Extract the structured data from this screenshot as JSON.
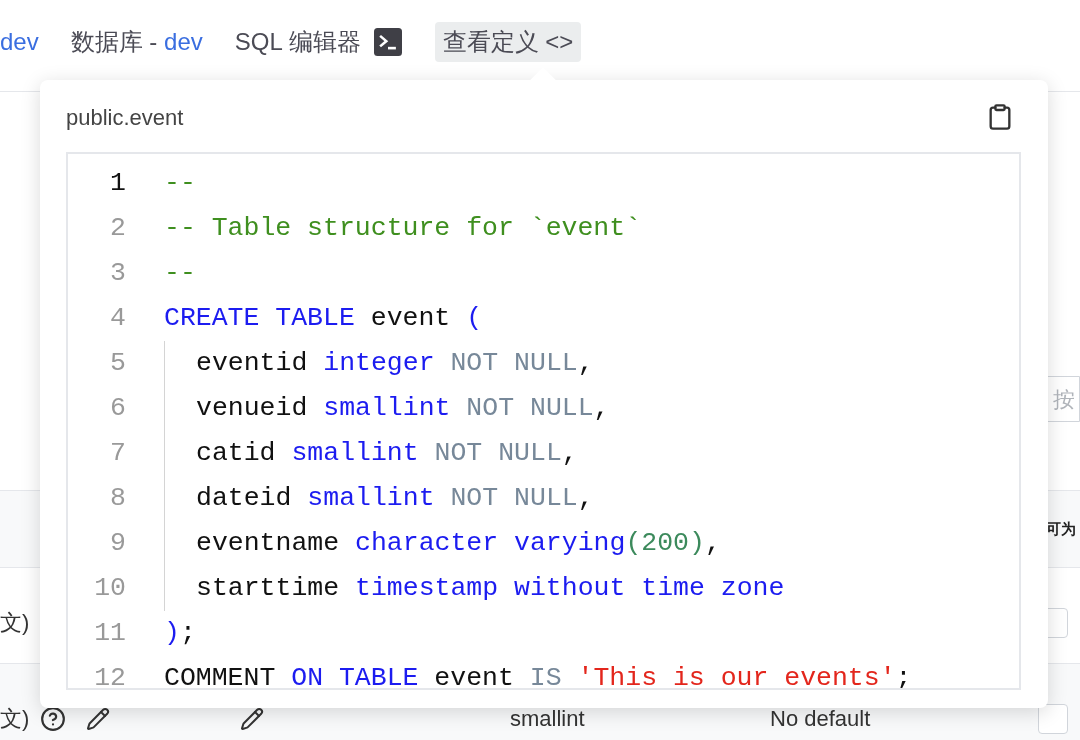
{
  "breadcrumb": [
    {
      "link": "dev"
    },
    {
      "label": "数据库 - ",
      "link": "dev"
    }
  ],
  "editor_link": {
    "label": "SQL 编辑器"
  },
  "view_definition_button": {
    "label": "查看定义",
    "symbol": "<>",
    "selected": true
  },
  "background": {
    "search_placeholder": "按",
    "header_cell": "可为",
    "rows": [
      {
        "column_1": "文)",
        "checked": false
      },
      {
        "column_1": "文)",
        "type": "smallint",
        "default": "No default",
        "checked": false
      }
    ]
  },
  "popover": {
    "title": "public.event",
    "lines": [
      {
        "number": "1",
        "indented": false,
        "tokens": [
          {
            "kind": "comment",
            "text": "--"
          }
        ]
      },
      {
        "number": "2",
        "indented": false,
        "tokens": [
          {
            "kind": "comment",
            "text": "-- Table structure for `event`"
          }
        ]
      },
      {
        "number": "3",
        "indented": false,
        "tokens": [
          {
            "kind": "comment",
            "text": "--"
          }
        ]
      },
      {
        "number": "4",
        "indented": false,
        "tokens": [
          {
            "kind": "keyword",
            "text": "CREATE TABLE"
          },
          {
            "kind": "plain",
            "text": " event "
          },
          {
            "kind": "keyword",
            "text": "("
          }
        ]
      },
      {
        "number": "5",
        "indented": true,
        "tokens": [
          {
            "kind": "plain",
            "text": "eventid "
          },
          {
            "kind": "keyword",
            "text": "integer"
          },
          {
            "kind": "muted",
            "text": " NOT NULL"
          },
          {
            "kind": "plain",
            "text": ","
          }
        ]
      },
      {
        "number": "6",
        "indented": true,
        "tokens": [
          {
            "kind": "plain",
            "text": "venueid "
          },
          {
            "kind": "keyword",
            "text": "smallint"
          },
          {
            "kind": "muted",
            "text": " NOT NULL"
          },
          {
            "kind": "plain",
            "text": ","
          }
        ]
      },
      {
        "number": "7",
        "indented": true,
        "tokens": [
          {
            "kind": "plain",
            "text": "catid "
          },
          {
            "kind": "keyword",
            "text": "smallint"
          },
          {
            "kind": "muted",
            "text": " NOT NULL"
          },
          {
            "kind": "plain",
            "text": ","
          }
        ]
      },
      {
        "number": "8",
        "indented": true,
        "tokens": [
          {
            "kind": "plain",
            "text": "dateid "
          },
          {
            "kind": "keyword",
            "text": "smallint"
          },
          {
            "kind": "muted",
            "text": " NOT NULL"
          },
          {
            "kind": "plain",
            "text": ","
          }
        ]
      },
      {
        "number": "9",
        "indented": true,
        "tokens": [
          {
            "kind": "plain",
            "text": "eventname "
          },
          {
            "kind": "keyword",
            "text": "character varying"
          },
          {
            "kind": "number",
            "text": "(200)"
          },
          {
            "kind": "plain",
            "text": ","
          }
        ]
      },
      {
        "number": "10",
        "indented": true,
        "tokens": [
          {
            "kind": "plain",
            "text": "starttime "
          },
          {
            "kind": "keyword",
            "text": "timestamp without time zone"
          }
        ]
      },
      {
        "number": "11",
        "indented": false,
        "tokens": [
          {
            "kind": "keyword",
            "text": ")"
          },
          {
            "kind": "plain",
            "text": ";"
          }
        ]
      },
      {
        "number": "12",
        "indented": false,
        "tokens": [
          {
            "kind": "plain",
            "text": "COMMENT "
          },
          {
            "kind": "keyword",
            "text": "ON TABLE"
          },
          {
            "kind": "plain",
            "text": " event "
          },
          {
            "kind": "muted",
            "text": "IS "
          },
          {
            "kind": "string",
            "text": "'This is our events'"
          },
          {
            "kind": "plain",
            "text": ";"
          }
        ]
      }
    ]
  }
}
